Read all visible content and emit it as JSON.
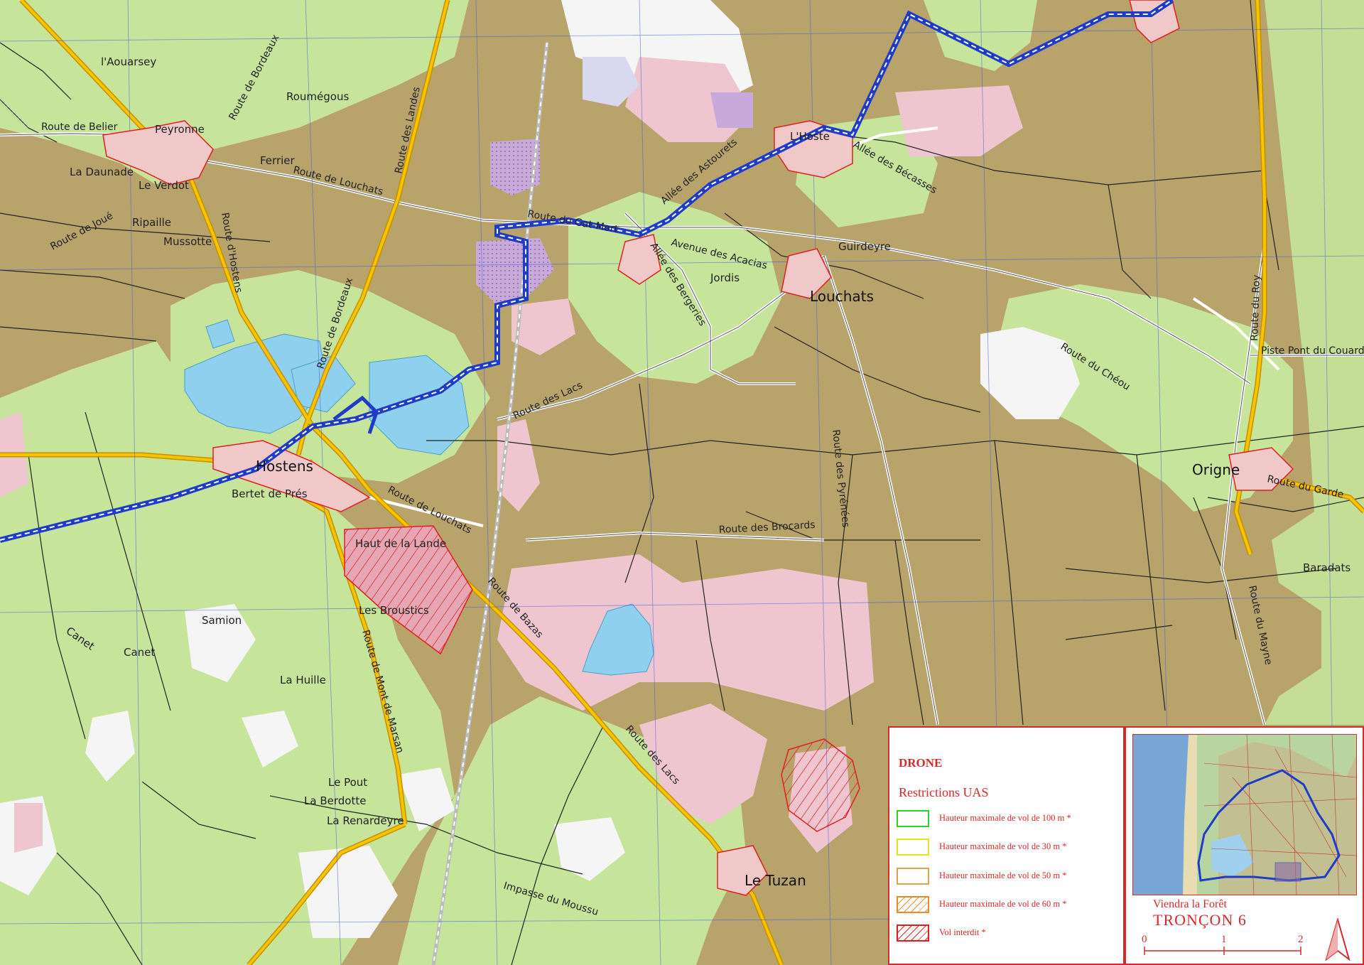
{
  "map": {
    "places": {
      "aouarsey": "l'Aouarsey",
      "roumegous": "Roumégous",
      "peyronne": "Peyronne",
      "daunade": "La Daunade",
      "verdot": "Le Verdot",
      "ferrier": "Ferrier",
      "ripaille": "Ripaille",
      "mussotte": "Mussotte",
      "lhoste": "L'Hoste",
      "guirdeyre": "Guirdeyre",
      "jordis": "Jordis",
      "louchats": "Louchats",
      "hostens": "Hostens",
      "bertet": "Bertet de Prés",
      "haut_lande": "Haut de la Lande",
      "broustics": "Les Broustics",
      "samion": "Samion",
      "canet": "Canet",
      "canet2": "Canet",
      "huille": "La Huille",
      "pout": "Le Pout",
      "berdotte": "La Berdotte",
      "renardeyre": "La Renardeyre",
      "tuzan": "Le Tuzan",
      "origne": "Origne",
      "baradats": "Baradats"
    },
    "roads": {
      "belier": "Route de Belier",
      "bordeaux1": "Route de Bordeaux",
      "landes": "Route des Landes",
      "louchats1": "Route de Louchats",
      "joue": "Route de Joué",
      "hostens": "Route d'Hostens",
      "bordeaux2": "Route de Bordeaux",
      "gatmort": "Route du Gat-Mort",
      "astourets": "Allée des Astourets",
      "becasses": "Allée des Bécasses",
      "acacias": "Avenue des Acacias",
      "bergeries": "Allée des Bergeries",
      "lacs1": "Route des Lacs",
      "louchats2": "Route de Louchats",
      "brocards": "Route des Brocards",
      "pyrenees": "Route des Pyrénées",
      "roy": "Route du Roy",
      "couarde": "Piste Pont du Couarde",
      "cheou": "Route du Chéou",
      "garde": "Route du Garde",
      "mayne": "Route du Mayne",
      "bazas": "Route de Bazas",
      "montmarsan": "Route de Mont de Marsan",
      "lacs2": "Route des Lacs",
      "moussu": "Impasse du Moussu"
    }
  },
  "legend": {
    "title": "DRONE",
    "subtitle": "Restrictions UAS",
    "items": [
      {
        "label": "Hauteur maximale de vol de 100 m *",
        "color": "#2bd12b"
      },
      {
        "label": "Hauteur maximale de vol de 30 m *",
        "color": "#e6e01e"
      },
      {
        "label": "Hauteur maximale de vol de 50 m *",
        "color": "#e0a050"
      },
      {
        "label": "Hauteur maximale de vol de 60 m *",
        "color": "#e88a2a"
      },
      {
        "label": "Vol interdit *",
        "color": "#e02020"
      }
    ]
  },
  "inset": {
    "caption1": "Viendra la Forêt",
    "caption2": "TRONÇON 6",
    "scale": {
      "ticks": [
        "0",
        "1",
        "2"
      ]
    }
  },
  "colors": {
    "forest": "#b8a36a",
    "green_zone": "#c6e49a",
    "pink_zone": "#efc6cf",
    "water": "#8fd0ef",
    "route": "#1e3cc8",
    "main_road": "#f1b300"
  }
}
